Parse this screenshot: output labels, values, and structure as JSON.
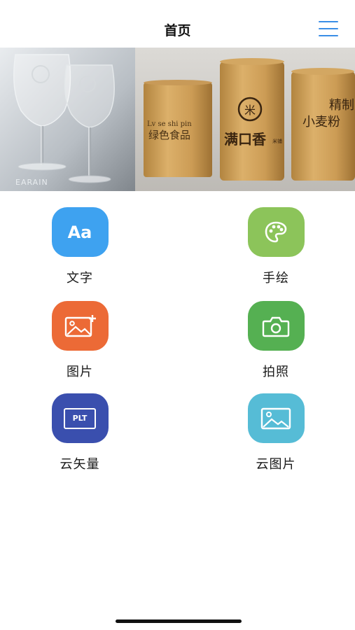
{
  "header": {
    "title": "首页",
    "menu_icon": "hamburger-menu-icon"
  },
  "banner": {
    "left_watermark": "EARAIN",
    "cup_left": {
      "line1": "Lv  se shi pin",
      "line2": "绿色食品"
    },
    "cup_middle": {
      "mark": "米",
      "text": "满口香",
      "small": "米铺"
    },
    "cup_right": {
      "text1": "精制",
      "text2": "小麦粉"
    }
  },
  "features": [
    {
      "label": "文字",
      "icon": "text-aa-icon",
      "color": "#3ea2f0",
      "glyph": "Aa"
    },
    {
      "label": "手绘",
      "icon": "palette-icon",
      "color": "#8cc45a"
    },
    {
      "label": "图片",
      "icon": "image-add-icon",
      "color": "#ec6a36"
    },
    {
      "label": "拍照",
      "icon": "camera-icon",
      "color": "#55b052"
    },
    {
      "label": "云矢量",
      "icon": "plt-file-icon",
      "color": "#3a4fae",
      "glyph": "PLT"
    },
    {
      "label": "云图片",
      "icon": "cloud-image-icon",
      "color": "#56bcd6"
    }
  ]
}
